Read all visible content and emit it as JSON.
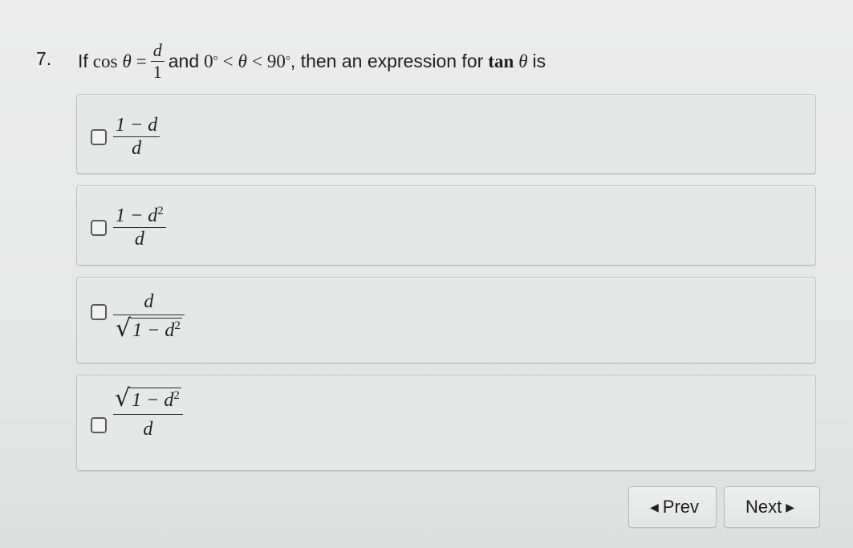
{
  "question": {
    "number": "7.",
    "prefix": "If",
    "cos_fn": "cos",
    "theta": "θ",
    "equals": "=",
    "given_num": "d",
    "given_den": "1",
    "connector": "and",
    "lower_bound": "0",
    "degree": "°",
    "lt": "<",
    "upper_bound": "90",
    "suffix": ", then an expression for",
    "tan_fn": "tan",
    "ending": "is"
  },
  "choices": [
    {
      "numerator": "1 − d",
      "denominator": "d",
      "selected": false
    },
    {
      "numerator": "1 − d",
      "numerator_exp": "2",
      "denominator": "d",
      "selected": false
    },
    {
      "numerator": "d",
      "denominator_radicand": "1 − d",
      "denominator_exp": "2",
      "selected": false
    },
    {
      "numerator_radicand": "1 − d",
      "numerator_exp": "2",
      "denominator": "d",
      "selected": false
    }
  ],
  "radical_symbol": "√",
  "navigation": {
    "prev_label": "Prev",
    "prev_arrow": "◀",
    "next_label": "Next",
    "next_arrow": "▶"
  }
}
